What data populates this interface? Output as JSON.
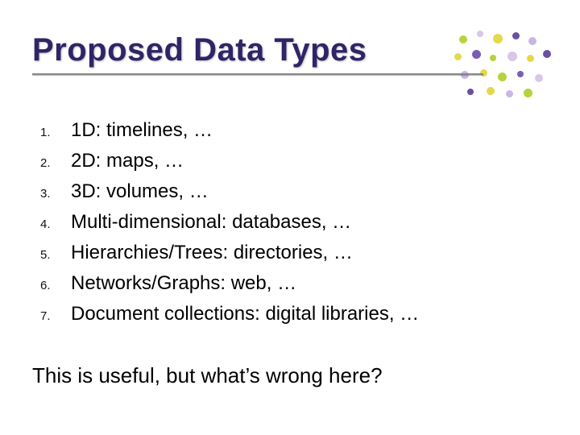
{
  "title": "Proposed Data Types",
  "items": [
    {
      "num": "1.",
      "text": "1D:  timelines, …"
    },
    {
      "num": "2.",
      "text": "2D:  maps, …"
    },
    {
      "num": "3.",
      "text": "3D:  volumes, …"
    },
    {
      "num": "4.",
      "text": "Multi-dimensional:  databases, …"
    },
    {
      "num": "5.",
      "text": "Hierarchies/Trees:  directories, …"
    },
    {
      "num": "6.",
      "text": "Networks/Graphs:  web, …"
    },
    {
      "num": "7.",
      "text": "Document collections:  digital libraries, …"
    }
  ],
  "footer": "This is useful, but what’s wrong here?",
  "colors": {
    "title": "#2f2566",
    "accent_dots": [
      "#b5d33d",
      "#e3d94a",
      "#6a4fa3",
      "#c9b6e4",
      "#d8c7e8",
      "#7a5fb0"
    ]
  }
}
